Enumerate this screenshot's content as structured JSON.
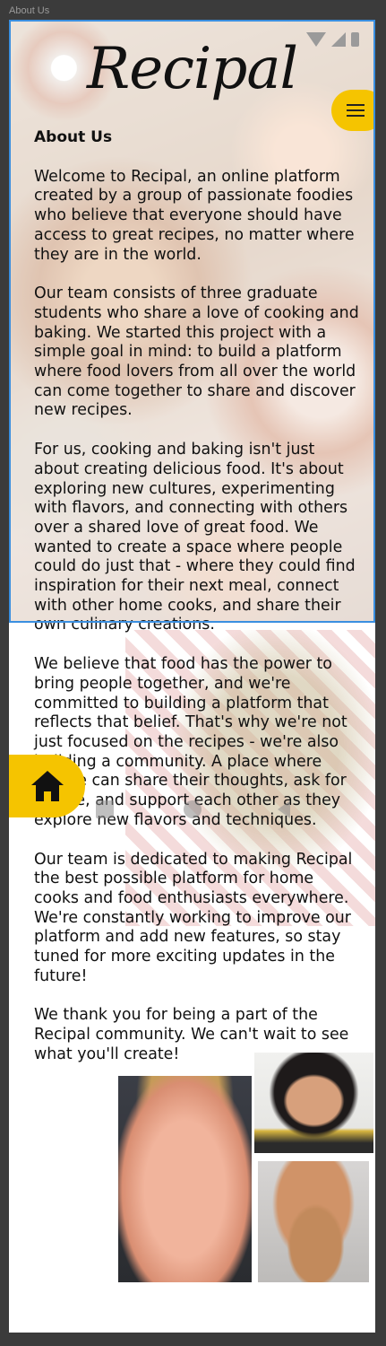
{
  "frame": {
    "label": "About Us"
  },
  "header": {
    "logo": "Recipal",
    "menu_icon": "hamburger-menu-icon",
    "status_icons": [
      "wifi-icon",
      "signal-icon",
      "battery-icon"
    ]
  },
  "page": {
    "heading": "About Us",
    "paragraphs": [
      "Welcome to Recipal, an online platform created by a group of passionate foodies who believe that everyone should have access to great recipes, no matter where they are in the world.",
      "Our team consists of three graduate students who share a love of cooking and baking. We started this project with a simple goal in mind: to build a platform where food lovers from all over the world can come together to share and discover new recipes.",
      "For us, cooking and baking isn't just about creating delicious food. It's about exploring new cultures, experimenting with flavors, and connecting with others over a shared love of great food. We wanted to create a space where people could do just that - where they could find inspiration for their next meal, connect with other home cooks, and share their own culinary creations.",
      "We believe that food has the power to bring people together, and we're committed to building a platform that reflects that belief. That's why we're not just focused on the recipes - we're also building a community. A place where people can share their thoughts, ask for advice, and support each other as they explore new flavors and techniques.",
      "Our team is dedicated to making Recipal the best possible platform for home cooks and food enthusiasts everywhere. We're constantly working to improve our platform and add new features, so stay tuned for more exciting updates in the future!",
      "We thank you for being a part of the Recipal community. We can't wait to see what you'll create!"
    ]
  },
  "nav": {
    "home_icon": "home-icon"
  },
  "colors": {
    "accent": "#f5c400",
    "selection": "#3a8fe0",
    "frame": "#3b3b3b"
  }
}
